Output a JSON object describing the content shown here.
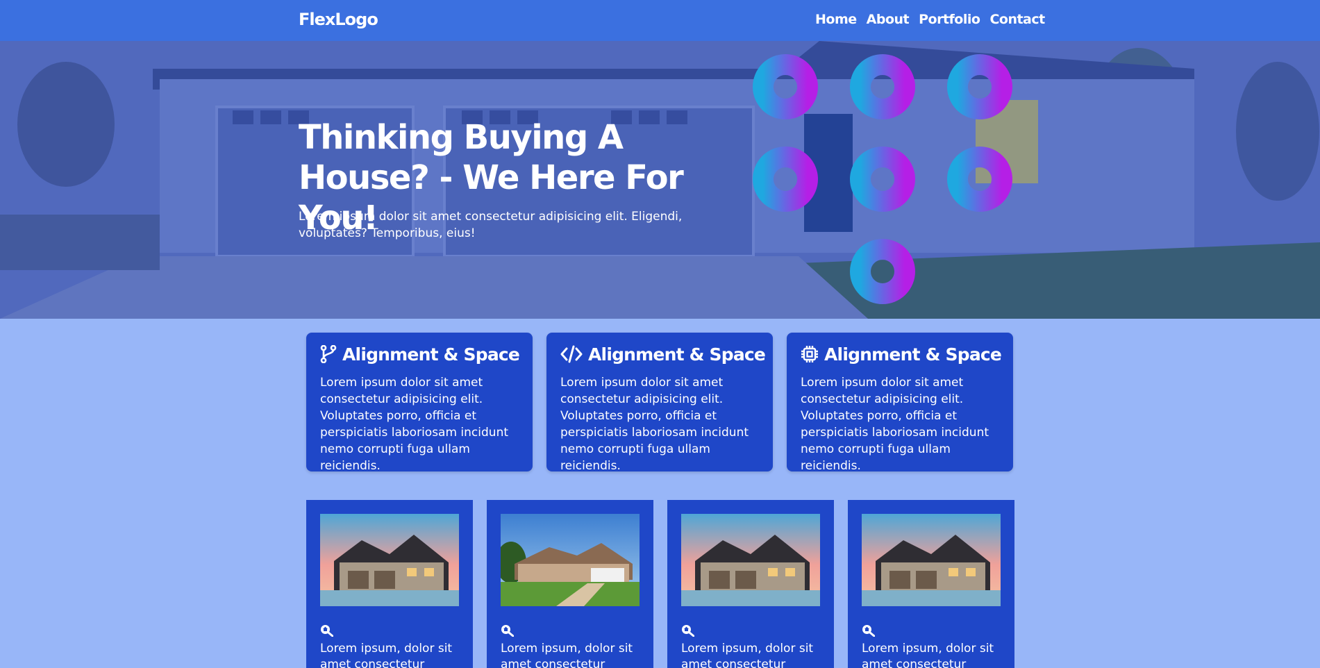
{
  "brand": {
    "logo": "FlexLogo"
  },
  "nav": {
    "items": [
      "Home",
      "About",
      "Portfolio",
      "Contact"
    ]
  },
  "hero": {
    "title": "Thinking Buying A House? - We Here For You!",
    "text": "Lorem ipsum dolor sit amet consectetur adipisicing elit. Eligendi, voluptates? Temporibus, eius!"
  },
  "features": [
    {
      "icon": "git-branch-icon",
      "title": "Alignment & Space",
      "text": "Lorem ipsum dolor sit amet consectetur adipisicing elit. Voluptates porro, officia et perspiciatis laboriosam incidunt nemo corrupti fuga ullam reiciendis."
    },
    {
      "icon": "code-icon",
      "title": "Alignment & Space",
      "text": "Lorem ipsum dolor sit amet consectetur adipisicing elit. Voluptates porro, officia et perspiciatis laboriosam incidunt nemo corrupti fuga ullam reiciendis."
    },
    {
      "icon": "cpu-chip-icon",
      "title": "Alignment & Space",
      "text": "Lorem ipsum dolor sit amet consectetur adipisicing elit. Voluptates porro, officia et perspiciatis laboriosam incidunt nemo corrupti fuga ullam reiciendis."
    }
  ],
  "portfolio": [
    {
      "icon": "search-house-icon",
      "text": "Lorem ipsum, dolor sit amet consectetur"
    },
    {
      "icon": "search-house-icon",
      "text": "Lorem ipsum, dolor sit amet consectetur"
    },
    {
      "icon": "search-house-icon",
      "text": "Lorem ipsum, dolor sit amet consectetur"
    },
    {
      "icon": "search-house-icon",
      "text": "Lorem ipsum, dolor sit amet consectetur"
    }
  ],
  "colors": {
    "nav": "#3b70e0",
    "page": "#98b6f8",
    "card": "#1f47c8",
    "ring_start": "#1fa8e0",
    "ring_end": "#b51fe6"
  }
}
